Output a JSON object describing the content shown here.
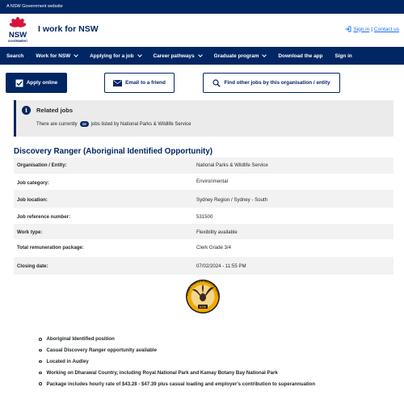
{
  "topbar": {
    "text": "A NSW Government website"
  },
  "header": {
    "logo_wordmark": "NSW",
    "logo_subtext": "GOVERNMENT",
    "site_title": "I work for NSW",
    "sign_in": "Sign in",
    "separator": "|",
    "contact_us": "Contact us"
  },
  "nav": {
    "items": [
      {
        "label": "Search",
        "has_dropdown": false
      },
      {
        "label": "Work for NSW",
        "has_dropdown": true
      },
      {
        "label": "Applying for a job",
        "has_dropdown": true
      },
      {
        "label": "Career pathways",
        "has_dropdown": true
      },
      {
        "label": "Graduate program",
        "has_dropdown": true
      },
      {
        "label": "Download the app",
        "has_dropdown": false
      },
      {
        "label": "Sign in",
        "has_dropdown": false
      }
    ]
  },
  "actions": {
    "apply": "Apply online",
    "email": "Email to a friend",
    "other_jobs": "Find other jobs by this organisation / entity"
  },
  "related": {
    "title": "Related jobs",
    "text_before": "There are currently",
    "count": "10",
    "text_after": "jobs listed by National Parks & Wildlife Service"
  },
  "job": {
    "title": "Discovery Ranger (Aboriginal Identified Opportunity)",
    "details": [
      {
        "label": "Organisation / Entity:",
        "value": "National Parks & Wildlife Service"
      },
      {
        "label": "Job category:",
        "value": "Environmental"
      },
      {
        "label": "Job location:",
        "value": "Sydney Region / Sydney - South"
      },
      {
        "label": "Job reference number:",
        "value": "531500"
      },
      {
        "label": "Work type:",
        "value": "Flexibility available"
      },
      {
        "label": "Total remuneration package:",
        "value": "Clerk Grade 3/4"
      },
      {
        "label": "Closing date:",
        "value": "07/02/2024 - 11:55 PM"
      }
    ],
    "bullets": [
      "Aboriginal Identified position",
      "Casual Discovery Ranger opportunity available",
      "Located in Audley",
      "Working on Dharawal Country, including Royal National Park and Kamay Botany Bay National Park",
      "Package includes hourly rate of $43.28 - $47.39 plus casual loading and employer's contribution to superannuation"
    ]
  },
  "emblem": {
    "ring_text": "NATIONAL PARKS & WILDLIFE SERVICE",
    "base_text": "NSW"
  },
  "colors": {
    "navy": "#002664",
    "link_blue": "#146cfd",
    "nsw_red": "#d7153a",
    "panel_grey": "#ebebeb"
  }
}
